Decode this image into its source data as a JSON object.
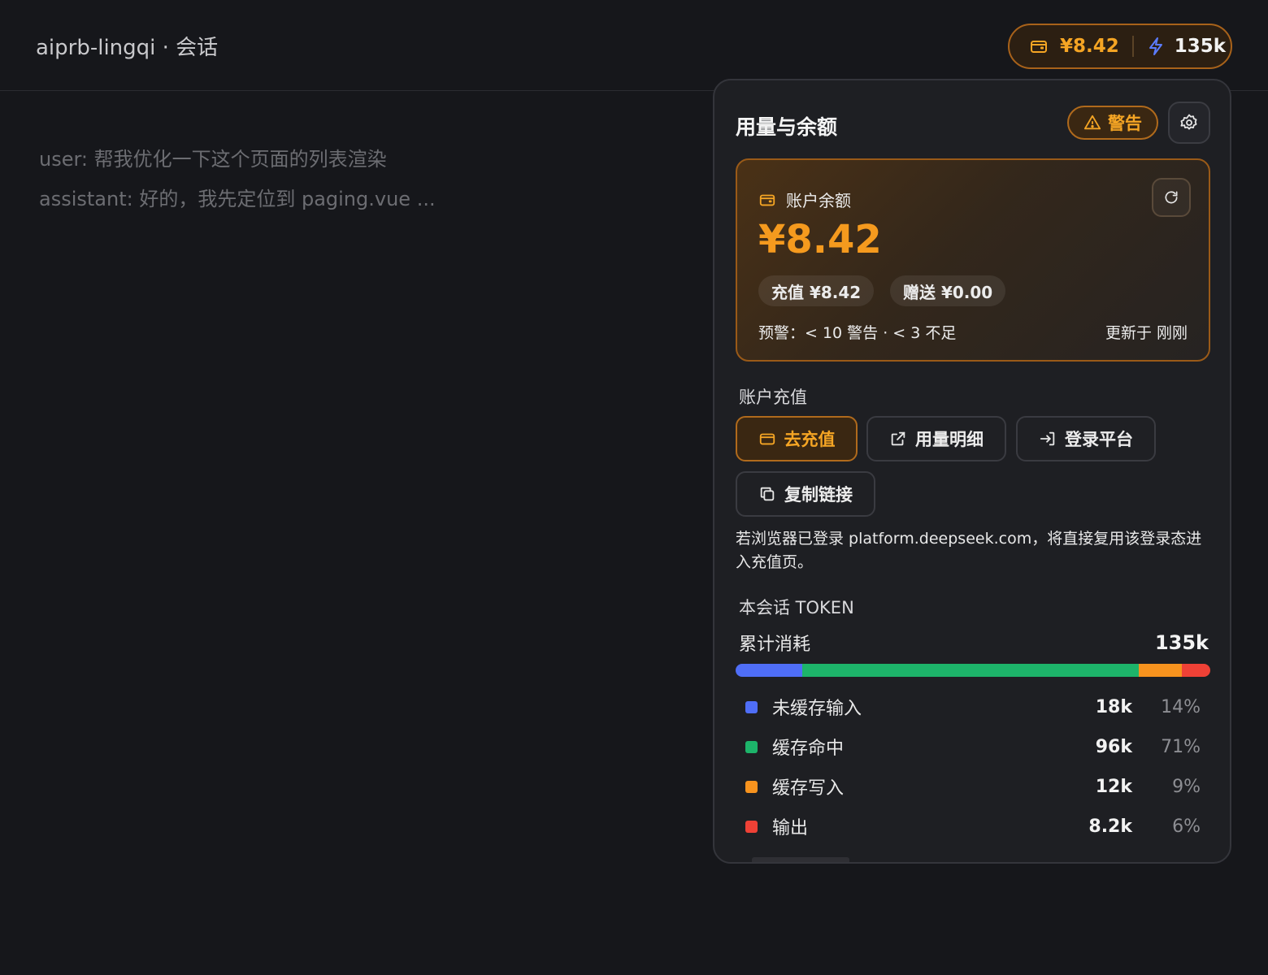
{
  "window_title": "aiprb-lingqi · 会话",
  "chip": {
    "balance": "¥8.42",
    "tokens": "135k",
    "wallet_icon": "wallet-icon",
    "bolt_icon": "bolt-icon"
  },
  "transcript": [
    "user: 帮我优化一下这个页面的列表渲染",
    "assistant: 好的，我先定位到 paging.vue ..."
  ],
  "popover": {
    "title": "用量与余额",
    "warning_badge": "警告",
    "balance_card": {
      "label": "账户余额",
      "amount": "¥8.42",
      "topup_pill": "充值 ¥8.42",
      "bonus_pill": "赠送 ¥0.00",
      "threshold": "预警：< 10 警告 · < 3 不足",
      "updated": "更新于 刚刚"
    },
    "recharge": {
      "section_label": "账户充值",
      "buttons": {
        "topup": "去充值",
        "details": "用量明细",
        "login": "登录平台",
        "copy": "复制链接"
      },
      "hint": "若浏览器已登录 platform.deepseek.com，将直接复用该登录态进入充值页。"
    },
    "tokens": {
      "section_label": "本会话 TOKEN",
      "total_label": "累计消耗",
      "total": "135k",
      "breakdown": [
        {
          "name": "未缓存输入",
          "value": "18k",
          "percent": "14%",
          "share": 14,
          "color": "#4f6ef7"
        },
        {
          "name": "缓存命中",
          "value": "96k",
          "percent": "71%",
          "share": 71,
          "color": "#1db46a"
        },
        {
          "name": "缓存写入",
          "value": "12k",
          "percent": "9%",
          "share": 9,
          "color": "#f7931e"
        },
        {
          "name": "输出",
          "value": "8.2k",
          "percent": "6%",
          "share": 6,
          "color": "#ef4136"
        }
      ]
    }
  },
  "colors": {
    "accent": "#f5a524",
    "background": "#16171b",
    "panel": "#1e1f23"
  }
}
